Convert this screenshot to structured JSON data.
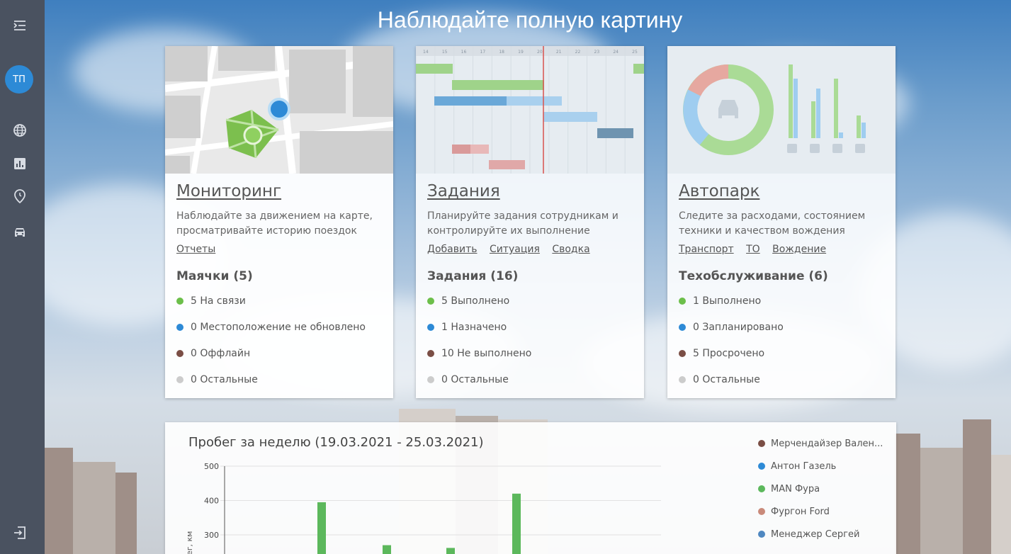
{
  "headline": "Наблюдайте полную картину",
  "sidebar": {
    "avatar_initials": "ТП",
    "icons": [
      "menu-icon",
      "globe-icon",
      "chart-icon",
      "clock-icon",
      "car-icon",
      "logout-icon"
    ]
  },
  "cards": [
    {
      "title": "Мониторинг",
      "desc": "Наблюдайте за движением на карте, просматривайте историю поездок",
      "links": [
        "Отчеты"
      ],
      "section": "Маячки (5)",
      "stats": [
        {
          "text": "5 На связи",
          "color": "#6cbf4a"
        },
        {
          "text": "0 Местоположение не обновлено",
          "color": "#2d8ad6"
        },
        {
          "text": "0 Оффлайн",
          "color": "#7a4e45"
        },
        {
          "text": "0 Остальные",
          "color": "#cccccc"
        }
      ]
    },
    {
      "title": "Задания",
      "desc": "Планируйте задания сотрудникам и контролируйте их выполнение",
      "links": [
        "Добавить",
        "Ситуация",
        "Сводка"
      ],
      "section": "Задания (16)",
      "stats": [
        {
          "text": "5 Выполнено",
          "color": "#6cbf4a"
        },
        {
          "text": "1 Назначено",
          "color": "#2d8ad6"
        },
        {
          "text": "10 Не выполнено",
          "color": "#7a4e45"
        },
        {
          "text": "0 Остальные",
          "color": "#cccccc"
        }
      ],
      "gantt_days": [
        "14",
        "15",
        "16",
        "17",
        "18",
        "19",
        "20",
        "21",
        "22",
        "23",
        "24",
        "25"
      ]
    },
    {
      "title": "Автопарк",
      "desc": "Следите за расходами, состоянием техники и качеством вождения",
      "links": [
        "Транспорт",
        "ТО",
        "Вождение"
      ],
      "section": "Техобслуживание (6)",
      "stats": [
        {
          "text": "1 Выполнено",
          "color": "#6cbf4a"
        },
        {
          "text": "0 Запланировано",
          "color": "#2d8ad6"
        },
        {
          "text": "5 Просрочено",
          "color": "#7a4e45"
        },
        {
          "text": "0 Остальные",
          "color": "#cccccc"
        }
      ]
    }
  ],
  "mileage": {
    "title": "Пробег за неделю (19.03.2021 - 25.03.2021)",
    "ylabel_fragment": "ег, км",
    "legend": [
      {
        "name": "Мерчендайзер Вален...",
        "color": "#7a4e45"
      },
      {
        "name": "Антон Газель",
        "color": "#2d8ad6"
      },
      {
        "name": "MAN Фура",
        "color": "#5cb85c"
      },
      {
        "name": "Фургон Ford",
        "color": "#c98a7a"
      },
      {
        "name": "Менеджер Сергей",
        "color": "#4f88c0"
      }
    ]
  },
  "chart_data": {
    "type": "bar",
    "title": "Пробег за неделю (19.03.2021 - 25.03.2021)",
    "ylabel": "",
    "yticks": [
      300,
      400,
      500
    ],
    "ylim": [
      0,
      500
    ],
    "grid": true,
    "legend_position": "right",
    "series": [
      {
        "name": "MAN Фура",
        "values": [
          395,
          270,
          262,
          420
        ]
      }
    ],
    "x": [
      1,
      3,
      5,
      7
    ]
  }
}
